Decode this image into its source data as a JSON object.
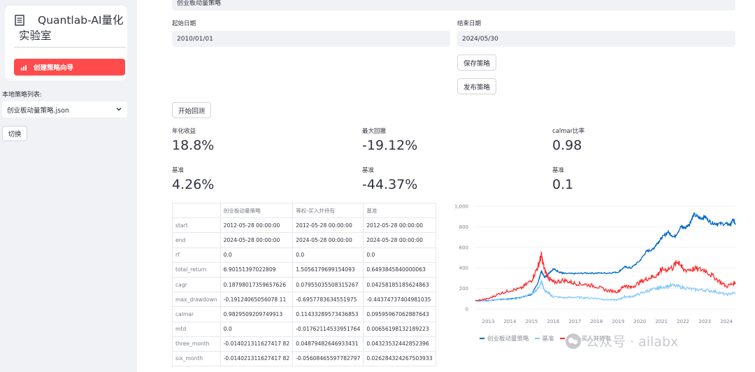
{
  "sidebar": {
    "app_title": "Quantlab-AI量化实验室",
    "wizard_button": "创建策略向导",
    "local_list_label": "本地策略列表:",
    "selected_strategy": "创业板动量策略.json",
    "switch_button": "切换"
  },
  "form": {
    "strategy_name": "创业板动量策略",
    "start_label": "起始日期",
    "start_value": "2010/01/01",
    "end_label": "结束日期",
    "end_value": "2024/05/30",
    "save_button": "保存策略",
    "publish_button": "发布策略",
    "run_button": "开始回测"
  },
  "metrics": {
    "cagr_label": "年化收益",
    "cagr_value": "18.8%",
    "mdd_label": "最大回撤",
    "mdd_value": "-19.12%",
    "calmar_label": "calmar比率",
    "calmar_value": "0.98",
    "bench_label": "基准",
    "bench_cagr": "4.26%",
    "bench_mdd": "-44.37%",
    "bench_calmar": "0.1"
  },
  "table": {
    "headers": [
      "",
      "创业板动量策略",
      "等权-买入并持有",
      "基准"
    ],
    "rows": [
      [
        "start",
        "2012-05-28 00:00:00",
        "2012-05-28 00:00:00",
        "2012-05-28 00:00:00"
      ],
      [
        "end",
        "2024-05-28 00:00:00",
        "2024-05-28 00:00:00",
        "2024-05-28 00:00:00"
      ],
      [
        "rf",
        "0.0",
        "0.0",
        "0.0"
      ],
      [
        "total_return",
        "6.90151397022809",
        "1.5056179699154093",
        "0.6493845840000063"
      ],
      [
        "cagr",
        "0.18798017359657626",
        "0.07955035508315267",
        "0.04258185185624863"
      ],
      [
        "max_drawdown",
        "-0.19124065056078 11",
        "-0.6957783634551975",
        "-0.44374737404981035"
      ],
      [
        "calmar",
        "0.9829509209749913",
        "0.11433289573436853",
        "0.09595967062887643"
      ],
      [
        "mtd",
        "0.0",
        "-0.01762114533951764",
        "0.00656198132189223"
      ],
      [
        "three_month",
        "-0.014021311627417 82",
        "0.04879482646933431",
        "0.04323532442852396"
      ],
      [
        "six_month",
        "-0.014021311627417 82",
        "-0.05608465597782797",
        "0.026284324267503933"
      ]
    ]
  },
  "chart_data": {
    "type": "line",
    "x_ticks": [
      "2013",
      "2014",
      "2015",
      "2016",
      "2017",
      "2018",
      "2019",
      "2020",
      "2021",
      "2022",
      "2023",
      "2024"
    ],
    "y_ticks": [
      "0",
      "200",
      "400",
      "600",
      "800",
      "1,000"
    ],
    "ylim": [
      0,
      1000
    ],
    "xlim": [
      2012.4,
      2024.42
    ],
    "series": [
      {
        "name": "创业板动量策略",
        "color": "#0068c9",
        "points": [
          [
            2012.4,
            80
          ],
          [
            2013.0,
            82
          ],
          [
            2013.5,
            95
          ],
          [
            2014.0,
            100
          ],
          [
            2014.5,
            115
          ],
          [
            2015.0,
            140
          ],
          [
            2015.3,
            260
          ],
          [
            2015.45,
            370
          ],
          [
            2015.6,
            310
          ],
          [
            2015.75,
            340
          ],
          [
            2016.0,
            390
          ],
          [
            2016.3,
            360
          ],
          [
            2016.5,
            345
          ],
          [
            2017.0,
            345
          ],
          [
            2017.5,
            350
          ],
          [
            2018.0,
            350
          ],
          [
            2018.5,
            350
          ],
          [
            2019.0,
            360
          ],
          [
            2019.3,
            410
          ],
          [
            2019.6,
            400
          ],
          [
            2020.0,
            470
          ],
          [
            2020.3,
            560
          ],
          [
            2020.6,
            580
          ],
          [
            2020.8,
            640
          ],
          [
            2021.0,
            690
          ],
          [
            2021.3,
            750
          ],
          [
            2021.6,
            700
          ],
          [
            2021.9,
            800
          ],
          [
            2022.1,
            790
          ],
          [
            2022.3,
            830
          ],
          [
            2022.5,
            920
          ],
          [
            2022.8,
            880
          ],
          [
            2023.0,
            900
          ],
          [
            2023.3,
            840
          ],
          [
            2023.6,
            830
          ],
          [
            2024.0,
            830
          ],
          [
            2024.2,
            820
          ],
          [
            2024.3,
            870
          ],
          [
            2024.42,
            830
          ]
        ]
      },
      {
        "name": "基准",
        "color": "#83c9ff",
        "points": [
          [
            2012.4,
            80
          ],
          [
            2013.0,
            82
          ],
          [
            2013.5,
            95
          ],
          [
            2014.0,
            90
          ],
          [
            2014.5,
            110
          ],
          [
            2015.0,
            150
          ],
          [
            2015.3,
            200
          ],
          [
            2015.45,
            270
          ],
          [
            2015.6,
            180
          ],
          [
            2015.8,
            150
          ],
          [
            2016.0,
            120
          ],
          [
            2016.5,
            110
          ],
          [
            2017.0,
            115
          ],
          [
            2017.5,
            110
          ],
          [
            2018.0,
            105
          ],
          [
            2018.5,
            90
          ],
          [
            2019.0,
            90
          ],
          [
            2019.3,
            120
          ],
          [
            2019.6,
            120
          ],
          [
            2020.0,
            150
          ],
          [
            2020.4,
            180
          ],
          [
            2020.8,
            200
          ],
          [
            2021.0,
            215
          ],
          [
            2021.5,
            230
          ],
          [
            2022.0,
            210
          ],
          [
            2022.5,
            190
          ],
          [
            2023.0,
            185
          ],
          [
            2023.5,
            170
          ],
          [
            2024.0,
            140
          ],
          [
            2024.42,
            160
          ]
        ]
      },
      {
        "name": "等权-买入并持有",
        "color": "#ff2b2b",
        "points": [
          [
            2012.4,
            80
          ],
          [
            2013.0,
            100
          ],
          [
            2013.5,
            150
          ],
          [
            2014.0,
            180
          ],
          [
            2014.5,
            200
          ],
          [
            2015.0,
            280
          ],
          [
            2015.3,
            420
          ],
          [
            2015.45,
            520
          ],
          [
            2015.6,
            380
          ],
          [
            2015.8,
            300
          ],
          [
            2016.0,
            260
          ],
          [
            2016.5,
            280
          ],
          [
            2017.0,
            250
          ],
          [
            2017.5,
            240
          ],
          [
            2018.0,
            220
          ],
          [
            2018.5,
            180
          ],
          [
            2019.0,
            170
          ],
          [
            2019.3,
            230
          ],
          [
            2019.6,
            210
          ],
          [
            2020.0,
            260
          ],
          [
            2020.4,
            300
          ],
          [
            2020.8,
            330
          ],
          [
            2021.0,
            380
          ],
          [
            2021.5,
            400
          ],
          [
            2021.8,
            470
          ],
          [
            2022.0,
            380
          ],
          [
            2022.5,
            390
          ],
          [
            2023.0,
            380
          ],
          [
            2023.5,
            300
          ],
          [
            2024.0,
            220
          ],
          [
            2024.42,
            260
          ]
        ]
      }
    ],
    "legend": [
      "创业板动量策略",
      "基准",
      "等权-买入并持有"
    ]
  },
  "watermark": "公众号 · ailabx"
}
